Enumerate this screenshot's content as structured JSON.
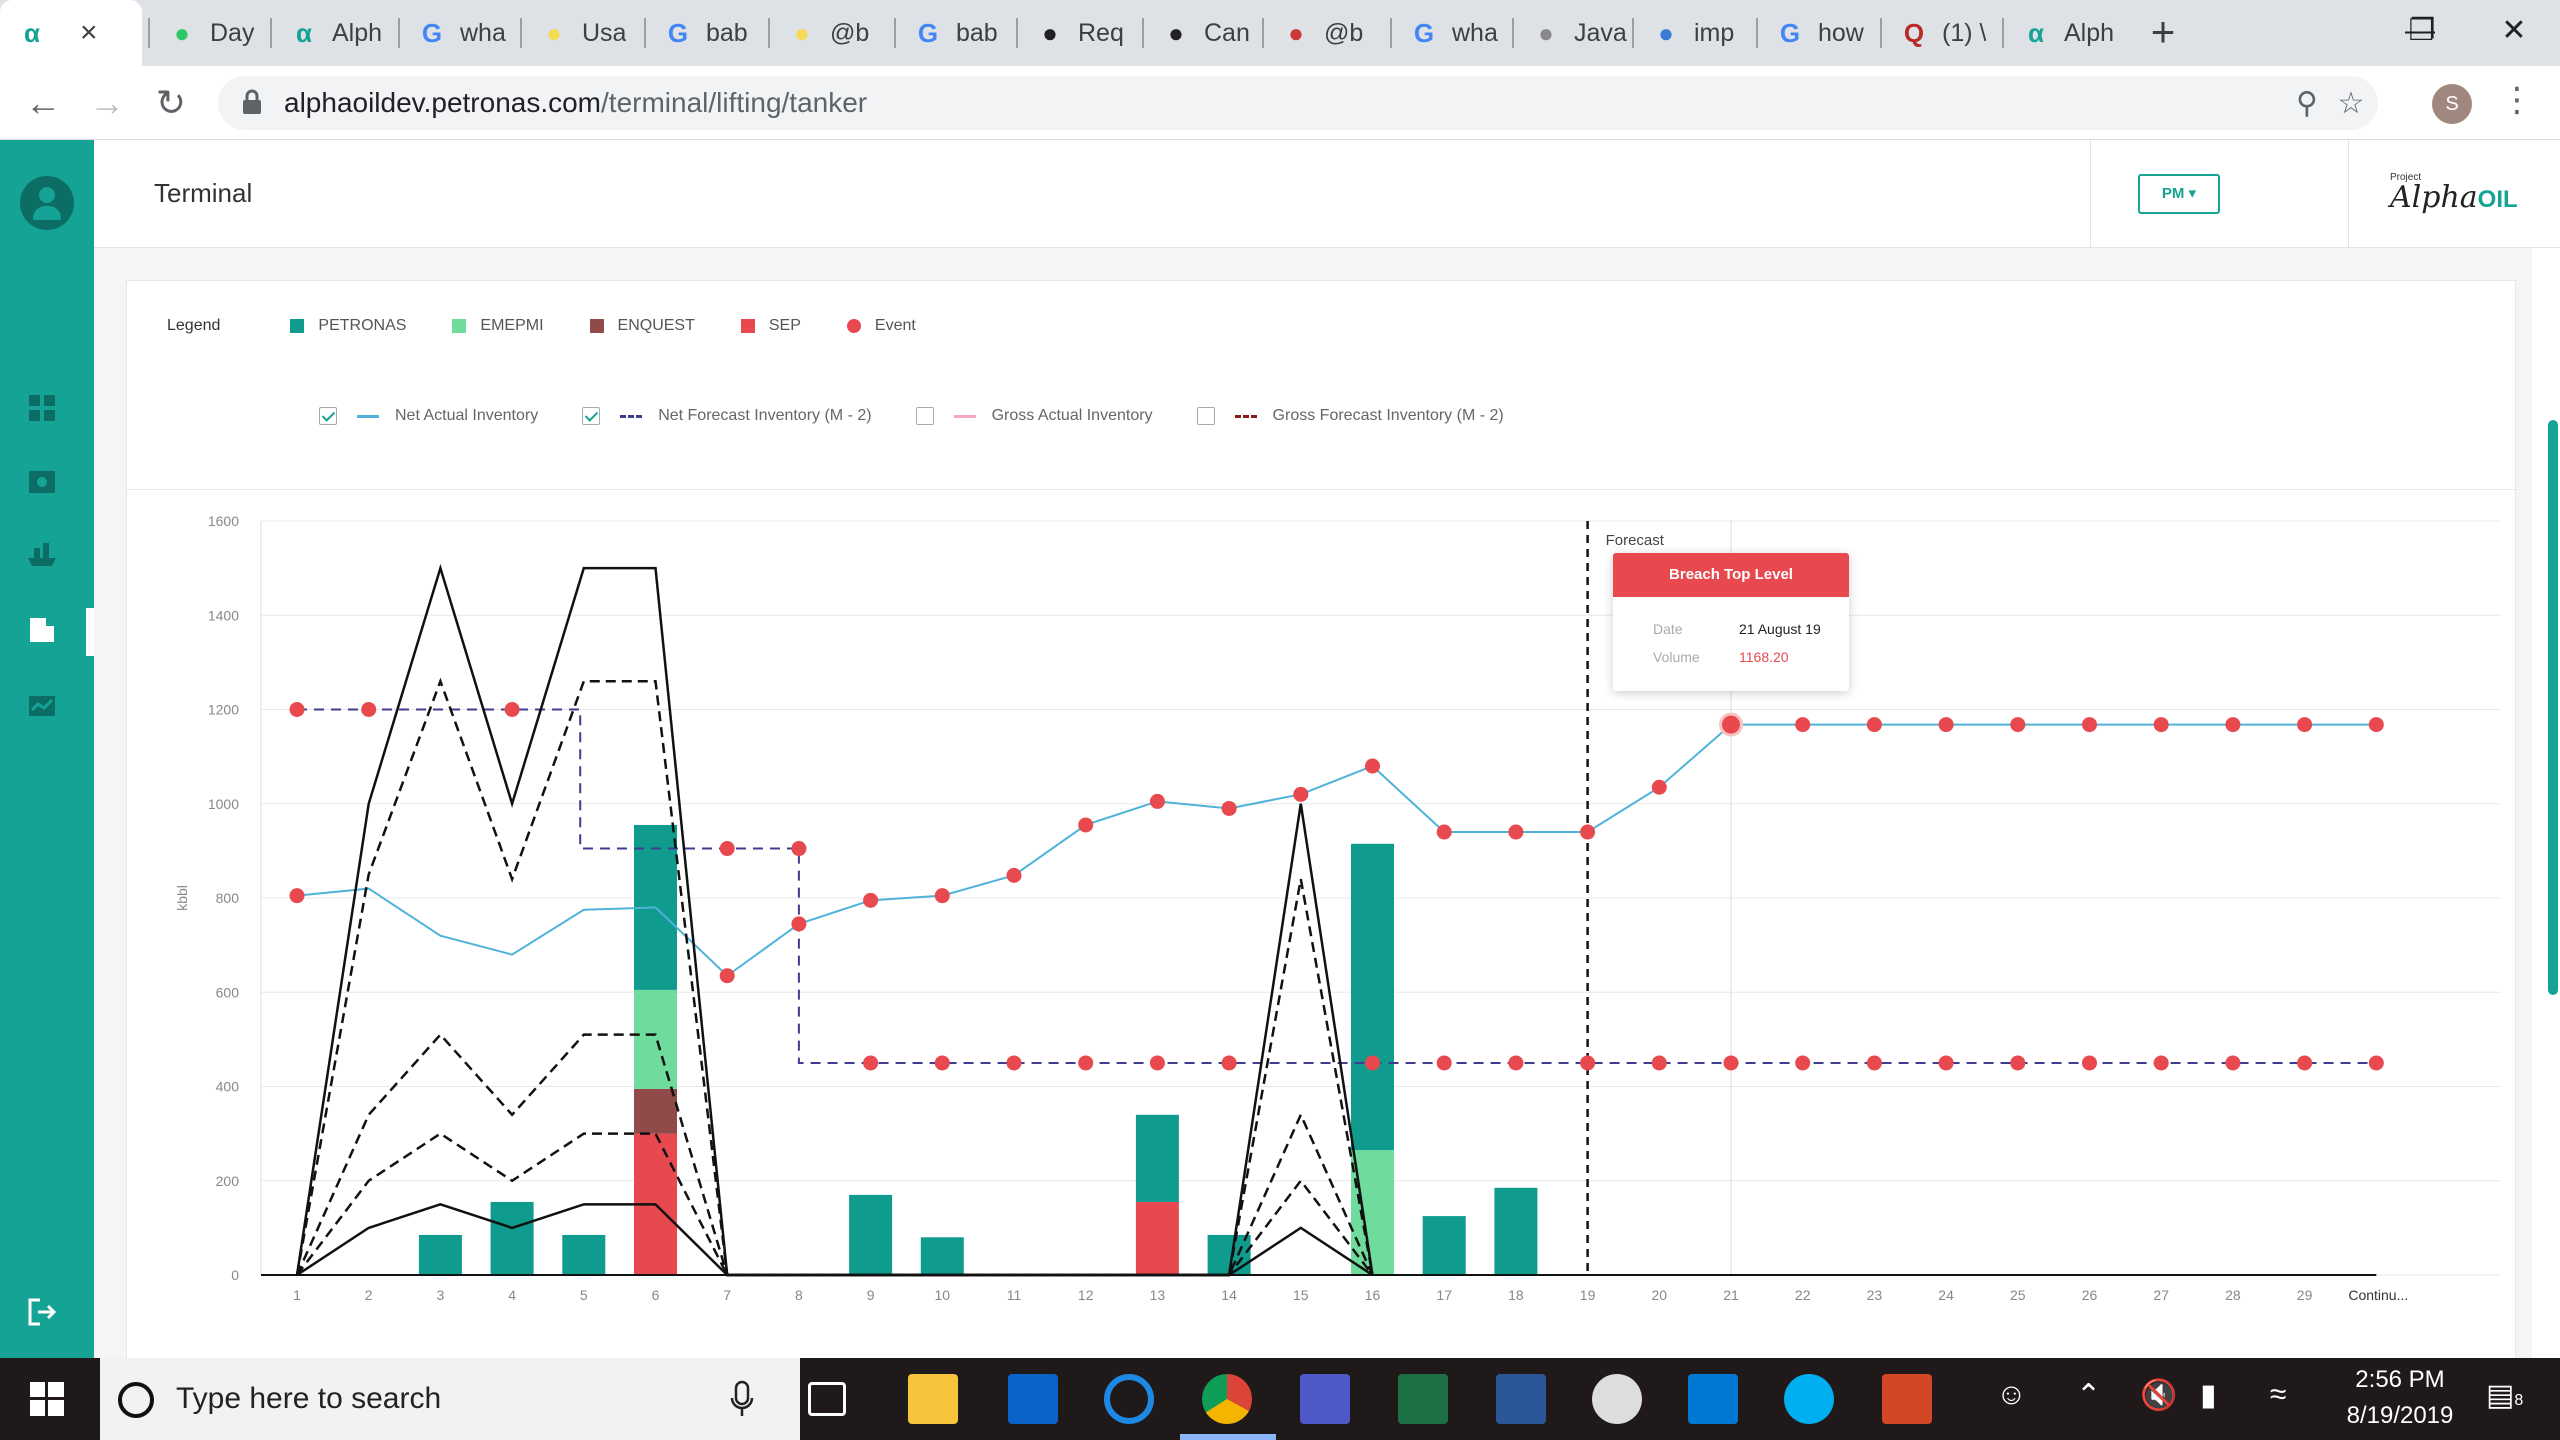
{
  "browser": {
    "tabs": [
      {
        "label": "",
        "favicon": "alpha-icon",
        "color": "#14a394",
        "active": true
      },
      {
        "label": "Day",
        "favicon": "hackerrank-icon",
        "color": "#2ec866"
      },
      {
        "label": "Alph",
        "favicon": "alpha-icon",
        "color": "#14a394"
      },
      {
        "label": "wha",
        "favicon": "google-icon",
        "color": "#4285f4"
      },
      {
        "label": "Usa",
        "favicon": "babel-icon",
        "color": "#f5da55"
      },
      {
        "label": "bab",
        "favicon": "google-icon",
        "color": "#4285f4"
      },
      {
        "label": "@b",
        "favicon": "babel-icon",
        "color": "#f5da55"
      },
      {
        "label": "bab",
        "favicon": "google-icon",
        "color": "#4285f4"
      },
      {
        "label": "Req",
        "favicon": "github-icon",
        "color": "#222"
      },
      {
        "label": "Can",
        "favicon": "github-icon",
        "color": "#222"
      },
      {
        "label": "@b",
        "favicon": "npm-icon",
        "color": "#cb3837"
      },
      {
        "label": "wha",
        "favicon": "google-icon",
        "color": "#4285f4"
      },
      {
        "label": "Java",
        "favicon": "appdividend-icon",
        "color": "#888"
      },
      {
        "label": "imp",
        "favicon": "bird-icon",
        "color": "#3a7bd5"
      },
      {
        "label": "how",
        "favicon": "google-icon",
        "color": "#4285f4"
      },
      {
        "label": "(1) \\",
        "favicon": "quora-icon",
        "color": "#b92b27"
      },
      {
        "label": "Alph",
        "favicon": "alpha-icon",
        "color": "#14a394"
      }
    ],
    "url_host": "alphaoildev.petronas.com",
    "url_path": "/terminal/lifting/tanker",
    "profile_initial": "S"
  },
  "header": {
    "title": "Terminal",
    "pm_label": "PM",
    "brand_project": "Project",
    "brand_alpha": "Alpha",
    "brand_oil": "OIL"
  },
  "legend": {
    "title": "Legend",
    "items": [
      {
        "label": "PETRONAS",
        "color": "#0f9b8e",
        "shape": "square"
      },
      {
        "label": "EMEPMI",
        "color": "#6fdb9c",
        "shape": "square"
      },
      {
        "label": "ENQUEST",
        "color": "#8f4a49",
        "shape": "square"
      },
      {
        "label": "SEP",
        "color": "#e8494f",
        "shape": "square"
      },
      {
        "label": "Event",
        "color": "#e8494f",
        "shape": "dot"
      }
    ]
  },
  "toggles": [
    {
      "label": "Net Actual Inventory",
      "checked": true,
      "color": "#4fb3d9",
      "style": "solid"
    },
    {
      "label": "Net Forecast Inventory (M - 2)",
      "checked": true,
      "color": "#3f3d8f",
      "style": "dashed"
    },
    {
      "label": "Gross Actual Inventory",
      "checked": false,
      "color": "#f3a6c0",
      "style": "solid"
    },
    {
      "label": "Gross Forecast Inventory (M - 2)",
      "checked": false,
      "color": "#8b1a1a",
      "style": "dashed"
    }
  ],
  "chart_data": {
    "type": "bar",
    "ylabel": "kbbl",
    "ylim": [
      0,
      1600
    ],
    "yticks": [
      0,
      200,
      400,
      600,
      800,
      1000,
      1200,
      1400,
      1600
    ],
    "x": [
      1,
      2,
      3,
      4,
      5,
      6,
      7,
      8,
      9,
      10,
      11,
      12,
      13,
      14,
      15,
      16,
      17,
      18,
      19,
      20,
      21,
      22,
      23,
      24,
      25,
      26,
      27,
      28,
      29
    ],
    "x_extra_label": "Continu...",
    "forecast_label": "Forecast",
    "forecast_x": 19,
    "bars": [
      {
        "x": 3,
        "PETRONAS": 85
      },
      {
        "x": 4,
        "PETRONAS": 155
      },
      {
        "x": 5,
        "PETRONAS": 85
      },
      {
        "x": 6,
        "SEP": 300,
        "ENQUEST": 95,
        "EMEPMI": 210,
        "PETRONAS": 350
      },
      {
        "x": 9,
        "PETRONAS": 170
      },
      {
        "x": 10,
        "PETRONAS": 80
      },
      {
        "x": 13,
        "SEP": 155,
        "PETRONAS": 185
      },
      {
        "x": 14,
        "PETRONAS": 85
      },
      {
        "x": 16,
        "EMEPMI": 265,
        "PETRONAS": 650
      },
      {
        "x": 17,
        "PETRONAS": 125
      },
      {
        "x": 18,
        "PETRONAS": 185
      }
    ],
    "series": [
      {
        "name": "Net Actual Inventory",
        "x": [
          1,
          2,
          3,
          4,
          5,
          6,
          7,
          8,
          9,
          10,
          11,
          12,
          13,
          14,
          15,
          16,
          17,
          18,
          19,
          20,
          21,
          22,
          23,
          24,
          25,
          26,
          27,
          28,
          29,
          30
        ],
        "values": [
          805,
          820,
          720,
          680,
          775,
          780,
          635,
          745,
          795,
          805,
          848,
          955,
          1005,
          990,
          1020,
          1080,
          940,
          940,
          940,
          1035,
          1168,
          1168,
          1168,
          1168,
          1168,
          1168,
          1168,
          1168,
          1168,
          1168
        ]
      },
      {
        "name": "Net Forecast Inventory (M - 2)",
        "x": [
          1,
          2,
          3,
          4,
          4.95,
          4.95,
          6,
          7,
          8,
          8,
          9,
          10,
          11,
          12,
          13,
          14,
          15,
          16,
          17,
          18,
          19,
          20,
          21,
          22,
          23,
          24,
          25,
          26,
          27,
          28,
          29,
          30
        ],
        "values": [
          1200,
          1200,
          1200,
          1200,
          1200,
          905,
          905,
          905,
          905,
          450,
          450,
          450,
          450,
          450,
          450,
          450,
          450,
          450,
          450,
          450,
          450,
          450,
          450,
          450,
          450,
          450,
          450,
          450,
          450,
          450,
          450,
          450
        ]
      },
      {
        "name": "Upper Limit",
        "x": [
          1,
          2,
          3,
          4,
          5,
          6,
          7,
          14,
          15,
          16
        ],
        "values": [
          0,
          1000,
          1500,
          1000,
          1500,
          1500,
          0,
          0,
          1000,
          0
        ]
      },
      {
        "name": "Upper Warning",
        "x": [
          1,
          2,
          3,
          4,
          5,
          6,
          7,
          14,
          15,
          16
        ],
        "values": [
          0,
          850,
          1260,
          840,
          1260,
          1260,
          0,
          0,
          840,
          0
        ]
      },
      {
        "name": "Mid Warning",
        "x": [
          1,
          2,
          3,
          4,
          5,
          6,
          7,
          14,
          15,
          16
        ],
        "values": [
          0,
          340,
          510,
          340,
          510,
          510,
          0,
          0,
          340,
          0
        ]
      },
      {
        "name": "Lower Warning",
        "x": [
          1,
          2,
          3,
          4,
          5,
          6,
          7,
          14,
          15,
          16
        ],
        "values": [
          0,
          200,
          300,
          200,
          300,
          300,
          0,
          0,
          200,
          0
        ]
      },
      {
        "name": "Lower Limit",
        "x": [
          1,
          2,
          3,
          4,
          5,
          6,
          7,
          14,
          15,
          16
        ],
        "values": [
          0,
          100,
          150,
          100,
          150,
          150,
          0,
          0,
          100,
          0
        ]
      }
    ],
    "events": [
      {
        "x": 1,
        "y": 1200
      },
      {
        "x": 2,
        "y": 1200
      },
      {
        "x": 4,
        "y": 1200
      },
      {
        "x": 7,
        "y": 905
      },
      {
        "x": 8,
        "y": 905
      },
      {
        "x": 1,
        "y": 805
      },
      {
        "x": 7,
        "y": 635
      },
      {
        "x": 8,
        "y": 745
      },
      {
        "x": 9,
        "y": 795
      },
      {
        "x": 10,
        "y": 805
      },
      {
        "x": 11,
        "y": 848
      },
      {
        "x": 12,
        "y": 955
      },
      {
        "x": 13,
        "y": 1005
      },
      {
        "x": 14,
        "y": 990
      },
      {
        "x": 15,
        "y": 1020
      },
      {
        "x": 16,
        "y": 1080
      },
      {
        "x": 17,
        "y": 940
      },
      {
        "x": 18,
        "y": 940
      },
      {
        "x": 19,
        "y": 940
      },
      {
        "x": 20,
        "y": 1035
      },
      {
        "x": 21,
        "y": 1168
      },
      {
        "x": 22,
        "y": 1168
      },
      {
        "x": 23,
        "y": 1168
      },
      {
        "x": 24,
        "y": 1168
      },
      {
        "x": 25,
        "y": 1168
      },
      {
        "x": 26,
        "y": 1168
      },
      {
        "x": 27,
        "y": 1168
      },
      {
        "x": 28,
        "y": 1168
      },
      {
        "x": 29,
        "y": 1168
      },
      {
        "x": 30,
        "y": 1168
      },
      {
        "x": 9,
        "y": 450
      },
      {
        "x": 10,
        "y": 450
      },
      {
        "x": 11,
        "y": 450
      },
      {
        "x": 12,
        "y": 450
      },
      {
        "x": 13,
        "y": 450
      },
      {
        "x": 14,
        "y": 450
      },
      {
        "x": 16,
        "y": 450
      },
      {
        "x": 17,
        "y": 450
      },
      {
        "x": 18,
        "y": 450
      },
      {
        "x": 19,
        "y": 450
      },
      {
        "x": 20,
        "y": 450
      },
      {
        "x": 21,
        "y": 450
      },
      {
        "x": 22,
        "y": 450
      },
      {
        "x": 23,
        "y": 450
      },
      {
        "x": 24,
        "y": 450
      },
      {
        "x": 25,
        "y": 450
      },
      {
        "x": 26,
        "y": 450
      },
      {
        "x": 27,
        "y": 450
      },
      {
        "x": 28,
        "y": 450
      },
      {
        "x": 29,
        "y": 450
      },
      {
        "x": 30,
        "y": 450
      }
    ],
    "hover_x": 21,
    "colors": {
      "PETRONAS": "#0f9b8e",
      "EMEPMI": "#6fdb9c",
      "ENQUEST": "#8f4a49",
      "SEP": "#e8494f",
      "event": "#e8494f",
      "net_actual": "#4fb3d9",
      "net_forecast": "#3f3d8f",
      "limit": "#111111"
    }
  },
  "tooltip": {
    "title": "Breach Top Level",
    "date_label": "Date",
    "date_value": "21 August 19",
    "volume_label": "Volume",
    "volume_value": "1168.20"
  },
  "taskbar": {
    "search_placeholder": "Type here to search",
    "time": "2:56 PM",
    "date": "8/19/2019",
    "notifications": "8"
  }
}
